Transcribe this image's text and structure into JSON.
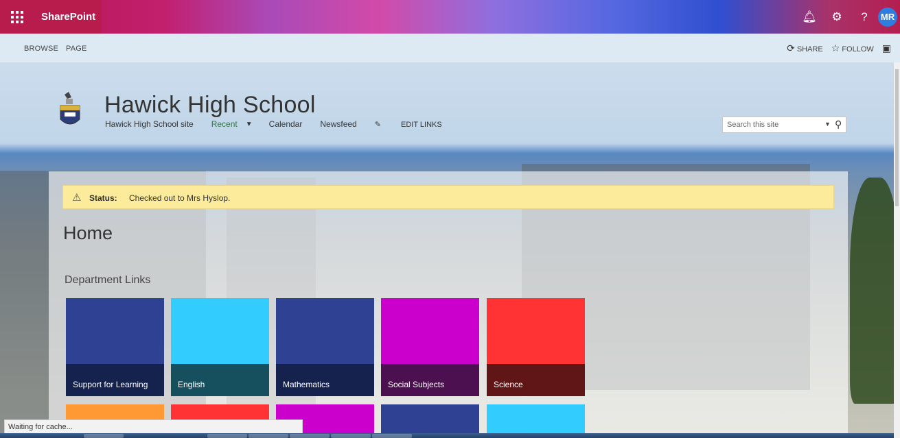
{
  "suitebar": {
    "app_name": "SharePoint",
    "user_initials": "MR",
    "icons": [
      "bell-icon",
      "gear-icon",
      "help-icon"
    ]
  },
  "ribbon": {
    "tabs": [
      "BROWSE",
      "PAGE"
    ],
    "share_label": "SHARE",
    "follow_label": "FOLLOW"
  },
  "site": {
    "title": "Hawick High School",
    "nav": {
      "home": "Hawick High School site",
      "recent": "Recent",
      "calendar": "Calendar",
      "newsfeed": "Newsfeed",
      "edit_links": "EDIT LINKS"
    },
    "search_placeholder": "Search this site"
  },
  "status": {
    "label": "Status:",
    "text": "Checked out to Mrs Hyslop."
  },
  "page": {
    "title": "Home",
    "section_title": "Department Links"
  },
  "tiles": [
    {
      "label": "Support for Learning",
      "color": "#2e4193",
      "caption_color": "#16224e"
    },
    {
      "label": "English",
      "color": "#33ccff",
      "caption_color": "#16505f"
    },
    {
      "label": "Mathematics",
      "color": "#2e4193",
      "caption_color": "#16224e"
    },
    {
      "label": "Social Subjects",
      "color": "#cc00cc",
      "caption_color": "#4c0f4f"
    },
    {
      "label": "Science",
      "color": "#ff3333",
      "caption_color": "#601616"
    }
  ],
  "tiles_row2_colors": [
    "#ff9933",
    "#ff3333",
    "#cc00cc",
    "#2e4193",
    "#33ccff"
  ],
  "browser_status": "Waiting for cache..."
}
